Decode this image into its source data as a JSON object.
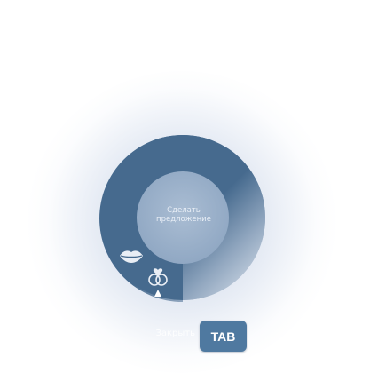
{
  "wheel": {
    "center_label": "Сделать предложение",
    "sectors": [
      {
        "name": "kiss",
        "icon": "lips-icon"
      },
      {
        "name": "propose",
        "icon": "rings-heart-icon"
      }
    ]
  },
  "hint": {
    "key_label": "TAB",
    "text": "Закрыть"
  },
  "colors": {
    "ring": "#466a8e",
    "ring_light": "#c9d4e2",
    "center": "#9fb4cc",
    "key_bg": "#4f79a0"
  }
}
